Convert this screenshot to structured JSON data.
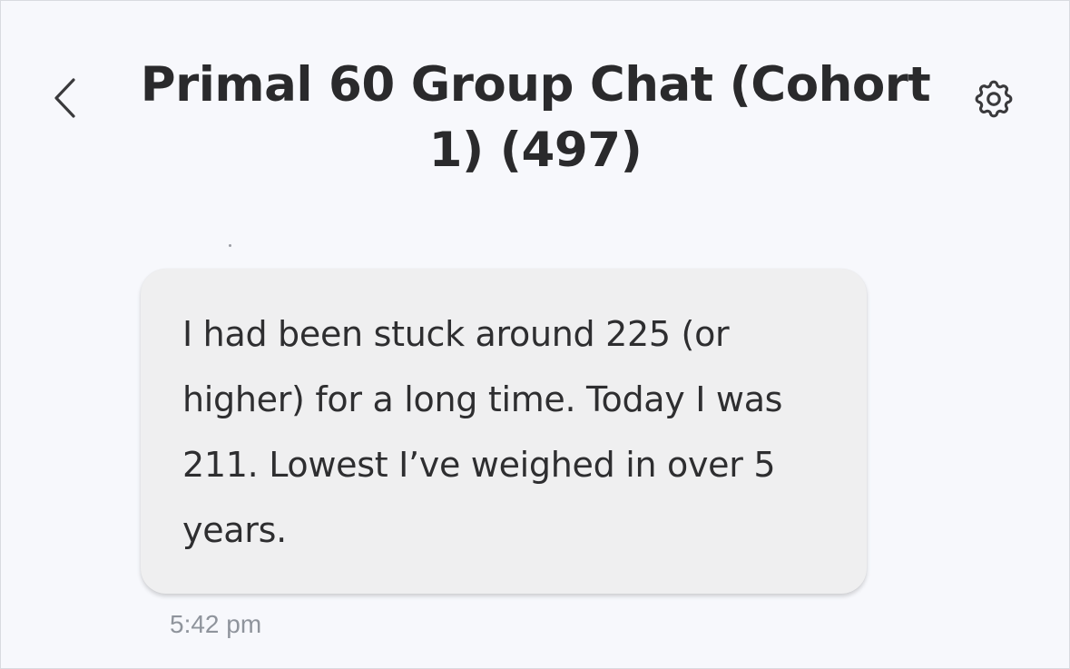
{
  "header": {
    "title": "Primal 60 Group Chat (Cohort 1) (497)",
    "back_icon": "chevron-left-icon",
    "settings_icon": "gear-icon"
  },
  "messages": [
    {
      "text": "I had been stuck around 225 (or higher) for a long time. Today I was 211. Lowest I’ve weighed in over 5 years.",
      "time": "5:42 pm"
    }
  ],
  "colors": {
    "background": "#f7f8fc",
    "bubble": "#efeff0",
    "text": "#2a2a2c",
    "timestamp": "#8f949c"
  }
}
